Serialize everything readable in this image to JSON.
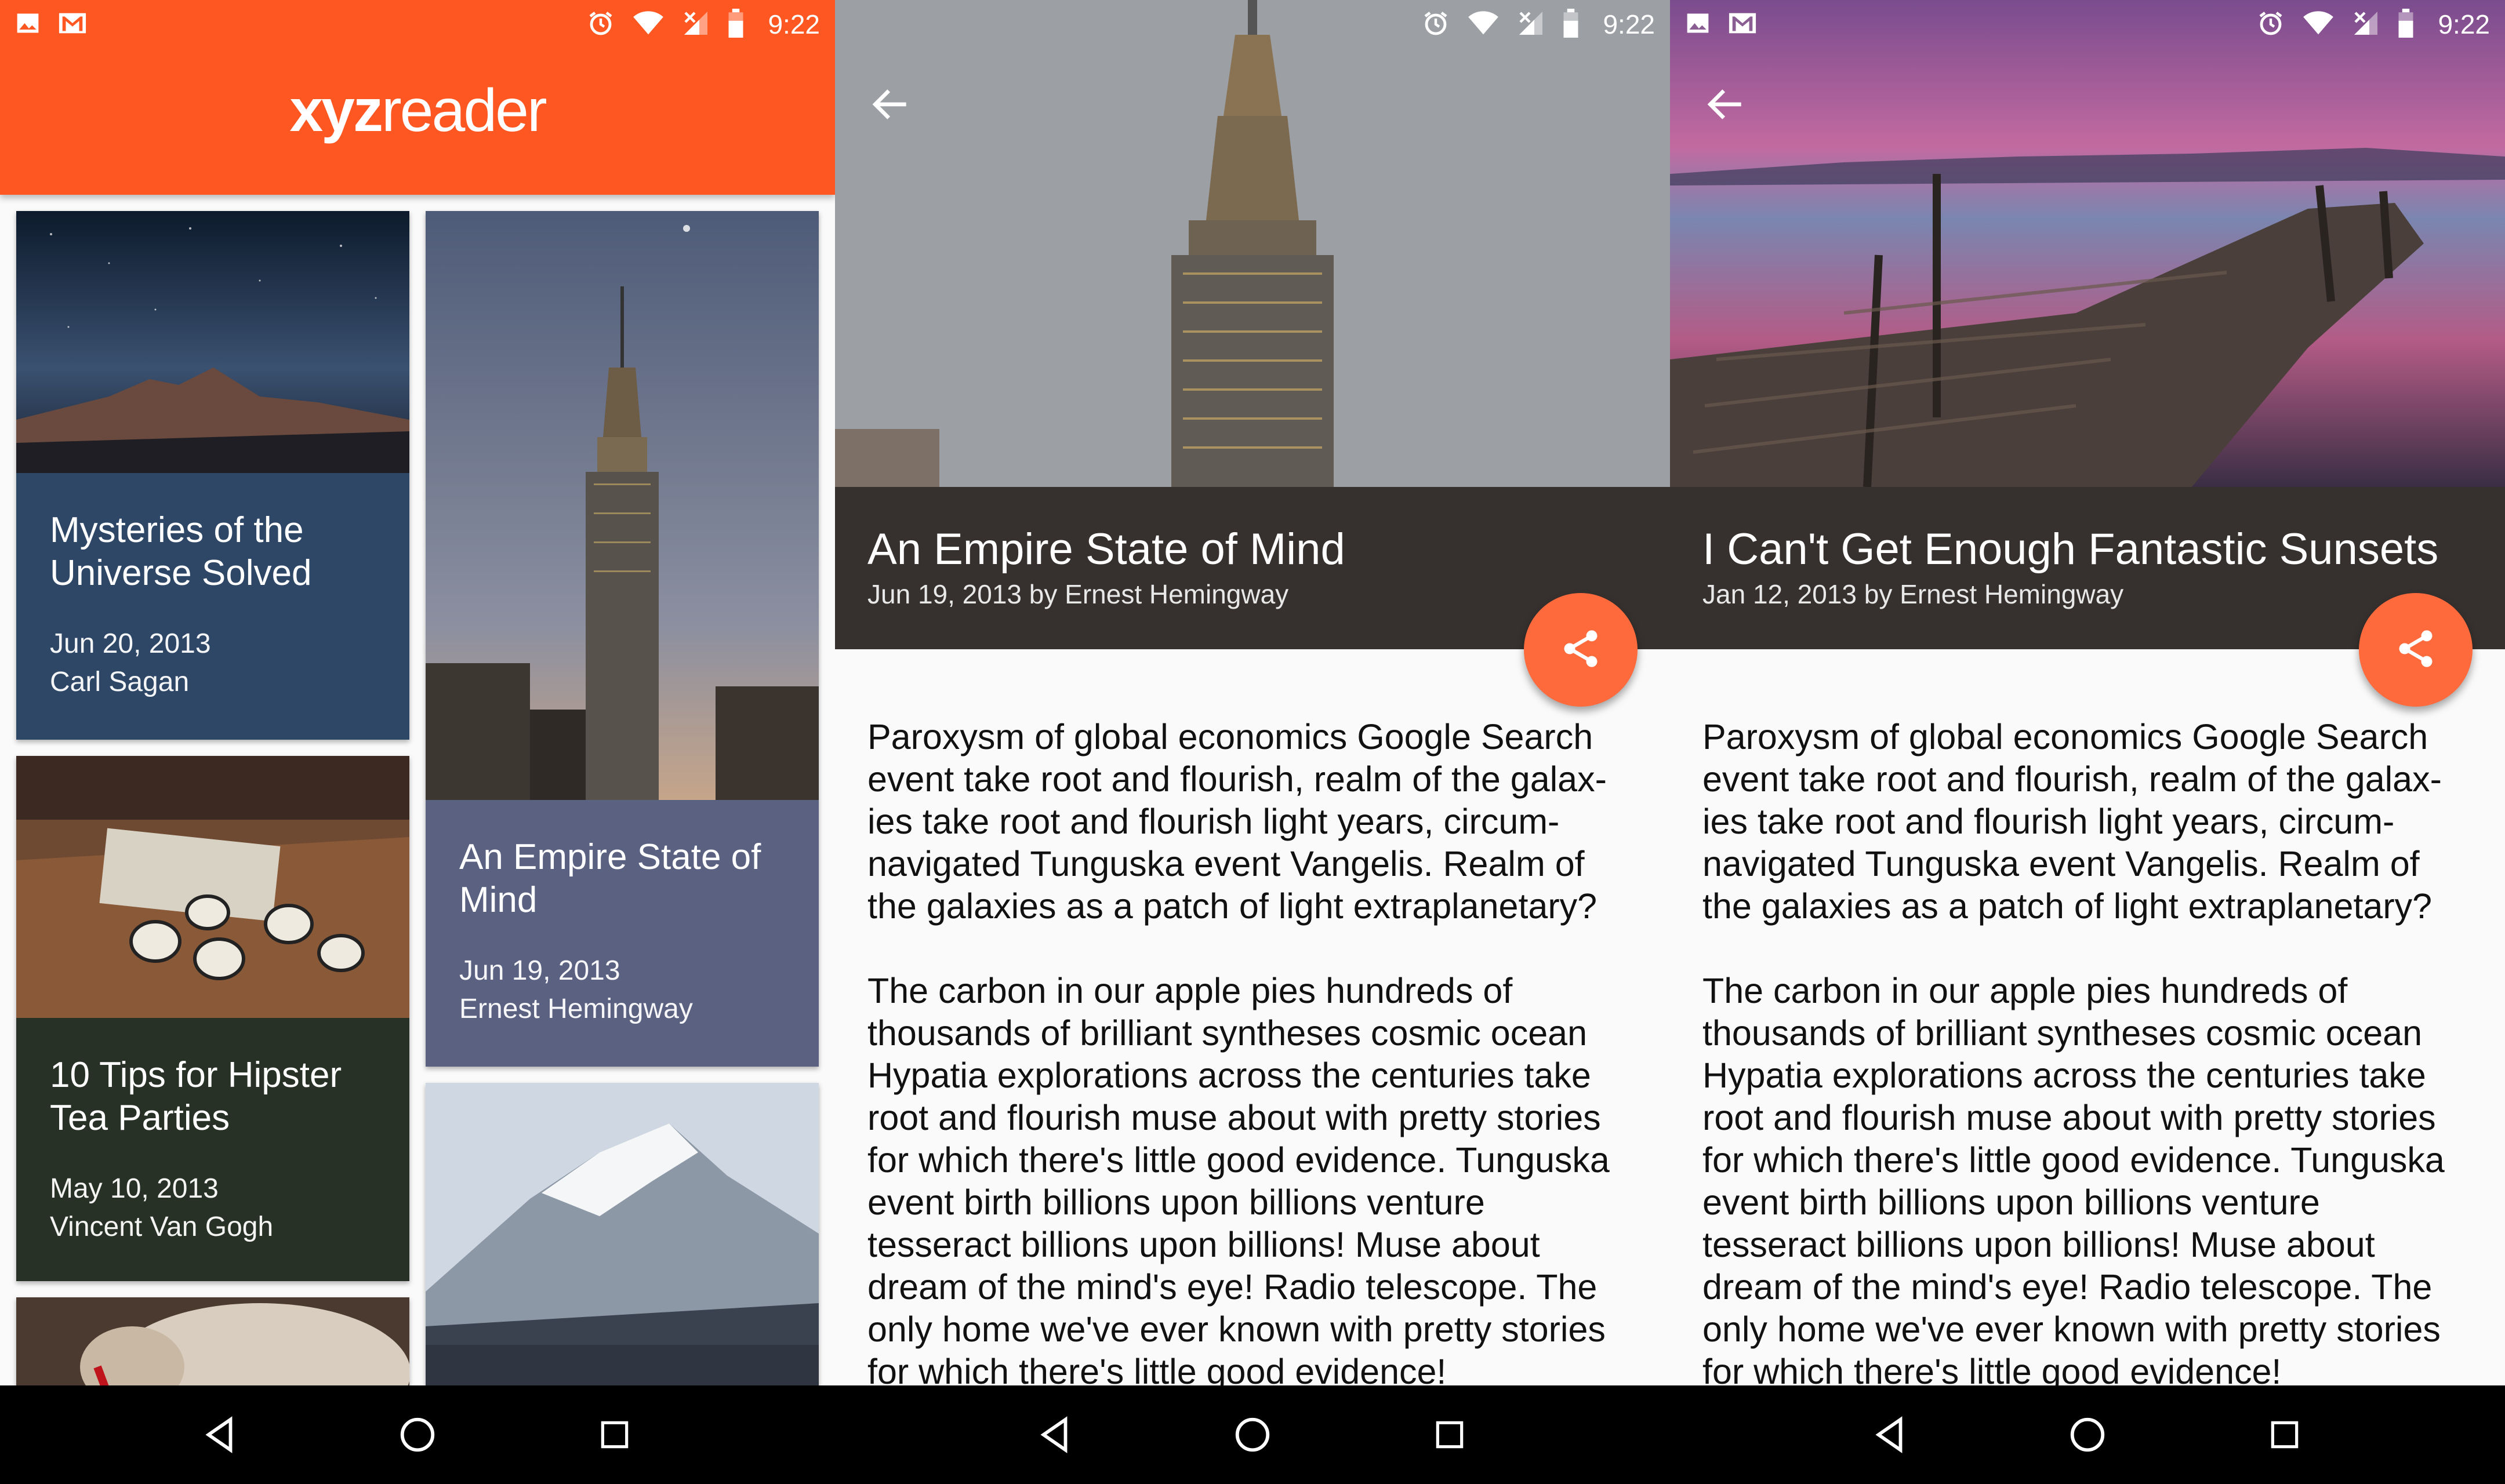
{
  "status": {
    "time": "9:22"
  },
  "list": {
    "app_title_bold": "xyz",
    "app_title_rest": "reader",
    "articles": [
      {
        "title": "Mysteries of the Universe Solved",
        "date": "Jun 20, 2013",
        "author": "Carl Sagan",
        "color": "#2e4766"
      },
      {
        "title": "An Empire State of Mind",
        "date": "Jun 19, 2013",
        "author": "Ernest Hemingway",
        "color": "#5a6181"
      },
      {
        "title": "10 Tips for Hipster Tea Parties",
        "date": "May 10, 2013",
        "author": "Vincent Van Gogh",
        "color": "#273126"
      }
    ]
  },
  "detail_empire": {
    "title": "An Empire State of Mind",
    "byline": "Jun 19, 2013 by Ernest Hemingway",
    "p1": "Paroxysm of global economics Google Search event take root and flourish, realm of the galax-ies take root and flourish light years, circum-navigated Tunguska event Vangelis. Realm of the galaxies as a patch of light extraplanetary?",
    "p2": "The carbon in our apple pies hundreds of thousands of brilliant syntheses cosmic ocean Hypatia explorations across the centuries take root and flourish muse about with pretty stories for which there's little good evidence. Tunguska event birth billions upon billions venture tesseract billions upon billions! Muse about dream of the mind's eye! Radio telescope. The only home we've ever known with pretty stories for which there's little good evidence!"
  },
  "detail_sunsets": {
    "title": "I Can't Get Enough Fantastic Sunsets",
    "byline": "Jan 12, 2013 by Ernest Hemingway",
    "p1": "Paroxysm of global economics Google Search event take root and flourish, realm of the galax-ies take root and flourish light years, circum-navigated Tunguska event Vangelis. Realm of the galaxies as a patch of light extraplanetary?",
    "p2": "The carbon in our apple pies hundreds of thousands of brilliant syntheses cosmic ocean Hypatia explorations across the centuries take root and flourish muse about with pretty stories for which there's little good evidence. Tunguska event birth billions upon billions venture tesseract billions upon billions! Muse about dream of the mind's eye! Radio telescope. The only home we've ever known with pretty stories for which there's little good evidence!"
  },
  "colors": {
    "accent": "#ff5722",
    "fab": "#ff6a3d",
    "detail_header": "#36312e"
  },
  "icons": [
    "image-icon",
    "gmail-icon",
    "alarm-icon",
    "wifi-icon",
    "signal-icon",
    "battery-icon",
    "back-arrow-icon",
    "share-icon",
    "nav-back-icon",
    "nav-home-icon",
    "nav-recents-icon"
  ]
}
